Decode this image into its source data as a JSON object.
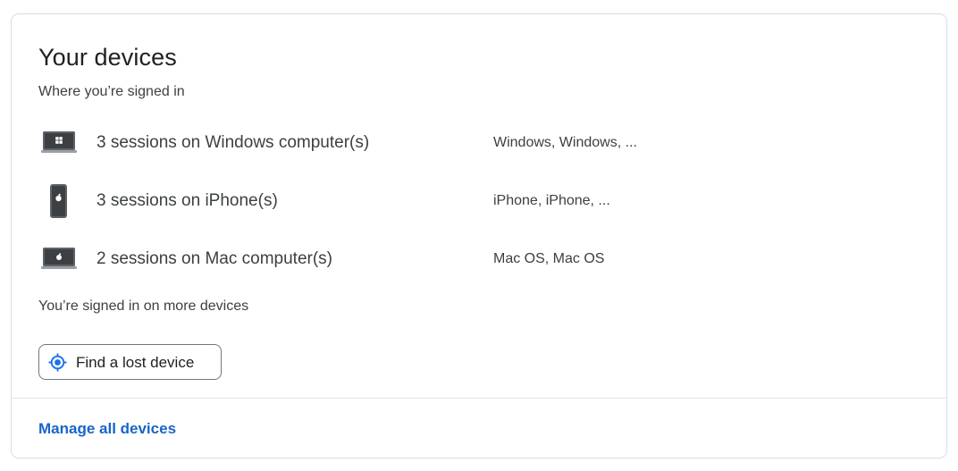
{
  "card": {
    "title": "Your devices",
    "subtitle": "Where you’re signed in"
  },
  "devices": [
    {
      "icon": "windows-laptop-icon",
      "label": "3 sessions on Windows computer(s)",
      "detail": "Windows, Windows, ..."
    },
    {
      "icon": "iphone-icon",
      "label": "3 sessions on iPhone(s)",
      "detail": "iPhone, iPhone, ..."
    },
    {
      "icon": "mac-laptop-icon",
      "label": "2 sessions on Mac computer(s)",
      "detail": "Mac OS, Mac OS"
    }
  ],
  "more_devices_note": "You’re signed in on more devices",
  "find_device": {
    "label": "Find a lost device",
    "icon": "location-target-icon"
  },
  "footer": {
    "manage_label": "Manage all devices"
  },
  "colors": {
    "link": "#1a64c8",
    "find_icon": "#1a73e8",
    "border": "#dadce0"
  }
}
